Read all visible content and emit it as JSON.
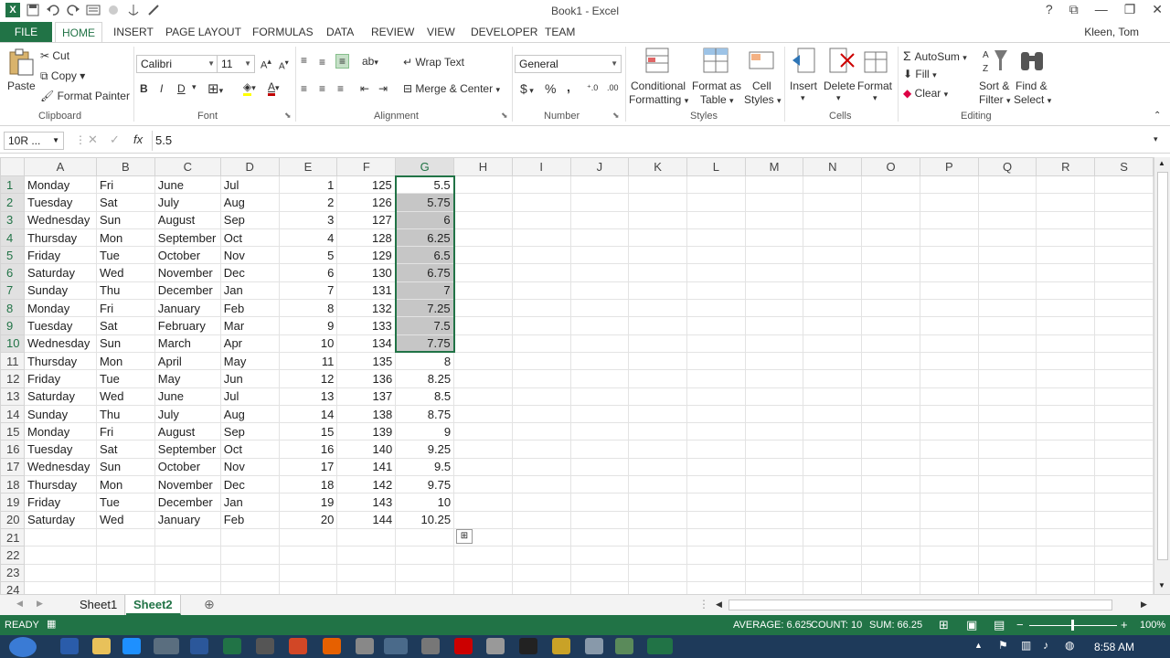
{
  "title_bar": {
    "title": "Book1 - Excel",
    "help": "?",
    "minimize": "—",
    "restore": "❐",
    "close": "✕"
  },
  "tabs": {
    "file": "FILE",
    "items": [
      "HOME",
      "INSERT",
      "PAGE LAYOUT",
      "FORMULAS",
      "DATA",
      "REVIEW",
      "VIEW",
      "DEVELOPER",
      "TEAM"
    ],
    "user": "Kleen, Tom"
  },
  "ribbon": {
    "clipboard": {
      "paste": "Paste",
      "cut": "Cut",
      "copy": "Copy",
      "format_painter": "Format Painter",
      "label": "Clipboard"
    },
    "font": {
      "name": "Calibri",
      "size": "11",
      "bold": "B",
      "italic": "I",
      "underline": "D",
      "label": "Font"
    },
    "alignment": {
      "wrap": "Wrap Text",
      "merge": "Merge & Center",
      "label": "Alignment"
    },
    "number": {
      "format": "General",
      "currency": "$",
      "percent": "%",
      "comma": ",",
      "label": "Number"
    },
    "styles": {
      "conditional": "Conditional",
      "conditional2": "Formatting",
      "format_as": "Format as",
      "table": "Table",
      "cell": "Cell",
      "cell2": "Styles",
      "label": "Styles"
    },
    "cells": {
      "insert": "Insert",
      "delete": "Delete",
      "format": "Format",
      "label": "Cells"
    },
    "editing": {
      "autosum": "AutoSum",
      "fill": "Fill",
      "clear": "Clear",
      "sort": "Sort &",
      "sort2": "Filter",
      "find": "Find &",
      "find2": "Select",
      "label": "Editing"
    }
  },
  "formula_bar": {
    "name_box": "10R ...",
    "fx": "fx",
    "value": "5.5"
  },
  "columns": [
    "A",
    "B",
    "C",
    "D",
    "E",
    "F",
    "G",
    "H",
    "I",
    "J",
    "K",
    "L",
    "M",
    "N",
    "O",
    "P",
    "Q",
    "R",
    "S"
  ],
  "rows": [
    [
      "1",
      "Monday",
      "Fri",
      "June",
      "Jul",
      "1",
      "125",
      "5.5"
    ],
    [
      "2",
      "Tuesday",
      "Sat",
      "July",
      "Aug",
      "2",
      "126",
      "5.75"
    ],
    [
      "3",
      "Wednesday",
      "Sun",
      "August",
      "Sep",
      "3",
      "127",
      "6"
    ],
    [
      "4",
      "Thursday",
      "Mon",
      "September",
      "Oct",
      "4",
      "128",
      "6.25"
    ],
    [
      "5",
      "Friday",
      "Tue",
      "October",
      "Nov",
      "5",
      "129",
      "6.5"
    ],
    [
      "6",
      "Saturday",
      "Wed",
      "November",
      "Dec",
      "6",
      "130",
      "6.75"
    ],
    [
      "7",
      "Sunday",
      "Thu",
      "December",
      "Jan",
      "7",
      "131",
      "7"
    ],
    [
      "8",
      "Monday",
      "Fri",
      "January",
      "Feb",
      "8",
      "132",
      "7.25"
    ],
    [
      "9",
      "Tuesday",
      "Sat",
      "February",
      "Mar",
      "9",
      "133",
      "7.5"
    ],
    [
      "10",
      "Wednesday",
      "Sun",
      "March",
      "Apr",
      "10",
      "134",
      "7.75"
    ],
    [
      "11",
      "Thursday",
      "Mon",
      "April",
      "May",
      "11",
      "135",
      "8"
    ],
    [
      "12",
      "Friday",
      "Tue",
      "May",
      "Jun",
      "12",
      "136",
      "8.25"
    ],
    [
      "13",
      "Saturday",
      "Wed",
      "June",
      "Jul",
      "13",
      "137",
      "8.5"
    ],
    [
      "14",
      "Sunday",
      "Thu",
      "July",
      "Aug",
      "14",
      "138",
      "8.75"
    ],
    [
      "15",
      "Monday",
      "Fri",
      "August",
      "Sep",
      "15",
      "139",
      "9"
    ],
    [
      "16",
      "Tuesday",
      "Sat",
      "September",
      "Oct",
      "16",
      "140",
      "9.25"
    ],
    [
      "17",
      "Wednesday",
      "Sun",
      "October",
      "Nov",
      "17",
      "141",
      "9.5"
    ],
    [
      "18",
      "Thursday",
      "Mon",
      "November",
      "Dec",
      "18",
      "142",
      "9.75"
    ],
    [
      "19",
      "Friday",
      "Tue",
      "December",
      "Jan",
      "19",
      "143",
      "10"
    ],
    [
      "20",
      "Saturday",
      "Wed",
      "January",
      "Feb",
      "20",
      "144",
      "10.25"
    ],
    [
      "21",
      "",
      "",
      "",
      "",
      "",
      "",
      ""
    ],
    [
      "22",
      "",
      "",
      "",
      "",
      "",
      "",
      ""
    ],
    [
      "23",
      "",
      "",
      "",
      "",
      "",
      "",
      ""
    ],
    [
      "24",
      "",
      "",
      "",
      "",
      "",
      "",
      ""
    ]
  ],
  "selection": {
    "column": "G",
    "first_row": 1,
    "last_row": 10
  },
  "sheets": {
    "tabs": [
      "Sheet1",
      "Sheet2"
    ],
    "active": "Sheet2"
  },
  "status": {
    "ready": "READY",
    "average": "AVERAGE: 6.625",
    "count": "COUNT: 10",
    "sum": "SUM: 66.25",
    "zoom": "100%"
  },
  "taskbar": {
    "time": "8:58 AM"
  },
  "colors": {
    "accent": "#217346",
    "selection": "#c6c6c6",
    "taskbar": "#1e3a5a"
  }
}
